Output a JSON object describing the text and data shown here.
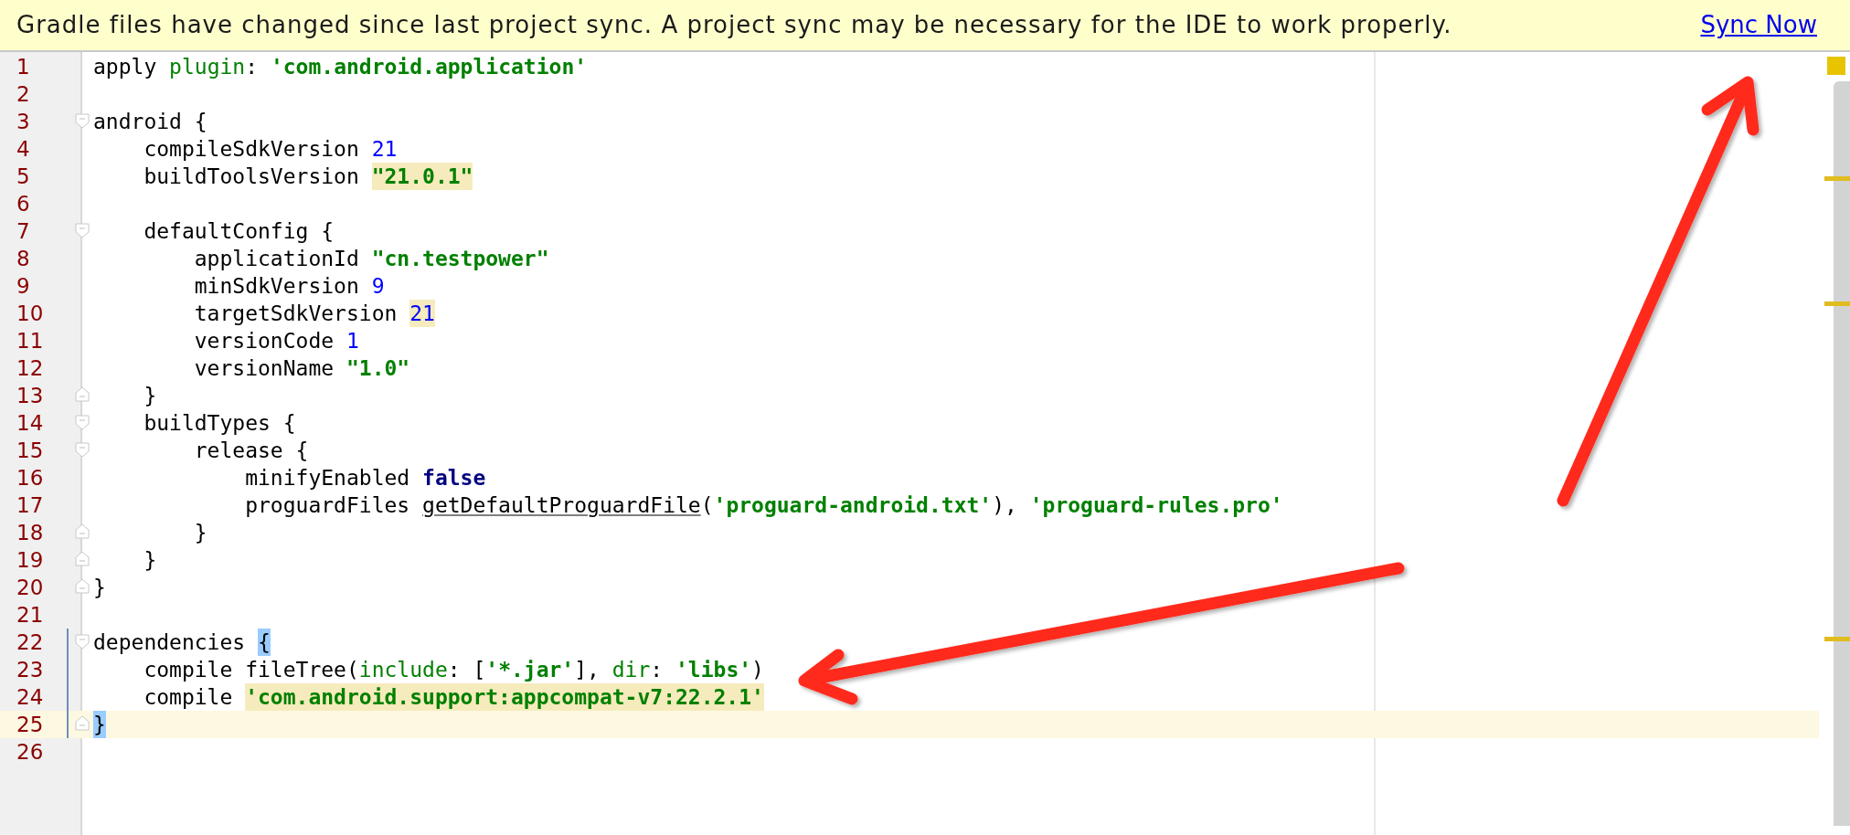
{
  "banner": {
    "message": "Gradle files have changed since last project sync. A project sync may be necessary for the IDE to work properly.",
    "link": "Sync Now"
  },
  "lines": [
    {
      "number": "1",
      "tokens": [
        {
          "text": "apply ",
          "kind": "plain"
        },
        {
          "text": "plugin",
          "kind": "named_arg"
        },
        {
          "text": ": ",
          "kind": "plain"
        },
        {
          "text": "'com.android.application'",
          "kind": "string"
        }
      ]
    },
    {
      "number": "2"
    },
    {
      "number": "3",
      "fold_start": true,
      "tokens": [
        {
          "text": "android {",
          "kind": "plain"
        }
      ]
    },
    {
      "number": "4",
      "tokens": [
        {
          "text": "    compileSdkVersion ",
          "kind": "plain"
        },
        {
          "text": "21",
          "kind": "number"
        }
      ]
    },
    {
      "number": "5",
      "tokens": [
        {
          "text": "    buildToolsVersion ",
          "kind": "plain"
        },
        {
          "text": "\"21.0.1\"",
          "kind": "string",
          "highlighted": true
        }
      ]
    },
    {
      "number": "6"
    },
    {
      "number": "7",
      "fold_start": true,
      "tokens": [
        {
          "text": "    defaultConfig {",
          "kind": "plain"
        }
      ]
    },
    {
      "number": "8",
      "tokens": [
        {
          "text": "        applicationId ",
          "kind": "plain"
        },
        {
          "text": "\"cn.testpower\"",
          "kind": "string"
        }
      ]
    },
    {
      "number": "9",
      "tokens": [
        {
          "text": "        minSdkVersion ",
          "kind": "plain"
        },
        {
          "text": "9",
          "kind": "number"
        }
      ]
    },
    {
      "number": "10",
      "tokens": [
        {
          "text": "        targetSdkVersion ",
          "kind": "plain"
        },
        {
          "text": "21",
          "kind": "number",
          "highlighted": true
        }
      ]
    },
    {
      "number": "11",
      "tokens": [
        {
          "text": "        versionCode ",
          "kind": "plain"
        },
        {
          "text": "1",
          "kind": "number"
        }
      ]
    },
    {
      "number": "12",
      "tokens": [
        {
          "text": "        versionName ",
          "kind": "plain"
        },
        {
          "text": "\"1.0\"",
          "kind": "string"
        }
      ]
    },
    {
      "number": "13",
      "fold_end": true,
      "tokens": [
        {
          "text": "    }",
          "kind": "plain"
        }
      ]
    },
    {
      "number": "14",
      "fold_start": true,
      "tokens": [
        {
          "text": "    buildTypes {",
          "kind": "plain"
        }
      ]
    },
    {
      "number": "15",
      "fold_start": true,
      "tokens": [
        {
          "text": "        release {",
          "kind": "plain"
        }
      ]
    },
    {
      "number": "16",
      "tokens": [
        {
          "text": "            minifyEnabled ",
          "kind": "plain"
        },
        {
          "text": "false",
          "kind": "keyword"
        }
      ]
    },
    {
      "number": "17",
      "tokens": [
        {
          "text": "            proguardFiles ",
          "kind": "plain"
        },
        {
          "text": "getDefaultProguardFile",
          "kind": "method"
        },
        {
          "text": "(",
          "kind": "plain"
        },
        {
          "text": "'proguard-android.txt'",
          "kind": "string"
        },
        {
          "text": "), ",
          "kind": "plain"
        },
        {
          "text": "'proguard-rules.pro'",
          "kind": "string"
        }
      ]
    },
    {
      "number": "18",
      "fold_end": true,
      "tokens": [
        {
          "text": "        }",
          "kind": "plain"
        }
      ]
    },
    {
      "number": "19",
      "fold_end": true,
      "tokens": [
        {
          "text": "    }",
          "kind": "plain"
        }
      ]
    },
    {
      "number": "20",
      "fold_end": true,
      "tokens": [
        {
          "text": "}",
          "kind": "plain"
        }
      ]
    },
    {
      "number": "21"
    },
    {
      "number": "22",
      "fold_start": true,
      "changed": true,
      "tokens": [
        {
          "text": "dependencies ",
          "kind": "plain"
        },
        {
          "text": "{",
          "kind": "plain",
          "matched_brace": true
        }
      ]
    },
    {
      "number": "23",
      "changed": true,
      "tokens": [
        {
          "text": "    compile fileTree(",
          "kind": "plain"
        },
        {
          "text": "include",
          "kind": "named_arg"
        },
        {
          "text": ": [",
          "kind": "plain"
        },
        {
          "text": "'*.jar'",
          "kind": "string"
        },
        {
          "text": "], ",
          "kind": "plain"
        },
        {
          "text": "dir",
          "kind": "named_arg"
        },
        {
          "text": ": ",
          "kind": "plain"
        },
        {
          "text": "'libs'",
          "kind": "string"
        },
        {
          "text": ")",
          "kind": "plain"
        }
      ]
    },
    {
      "number": "24",
      "changed": true,
      "tokens": [
        {
          "text": "    compile ",
          "kind": "plain"
        },
        {
          "text": "'com.android.support:appcompat-v7:22.2.1'",
          "kind": "string",
          "highlighted": true
        }
      ]
    },
    {
      "number": "25",
      "fold_end": true,
      "changed": true,
      "current": true,
      "tokens": [
        {
          "text": "}",
          "kind": "plain",
          "matched_brace": true
        }
      ]
    },
    {
      "number": "26"
    }
  ]
}
